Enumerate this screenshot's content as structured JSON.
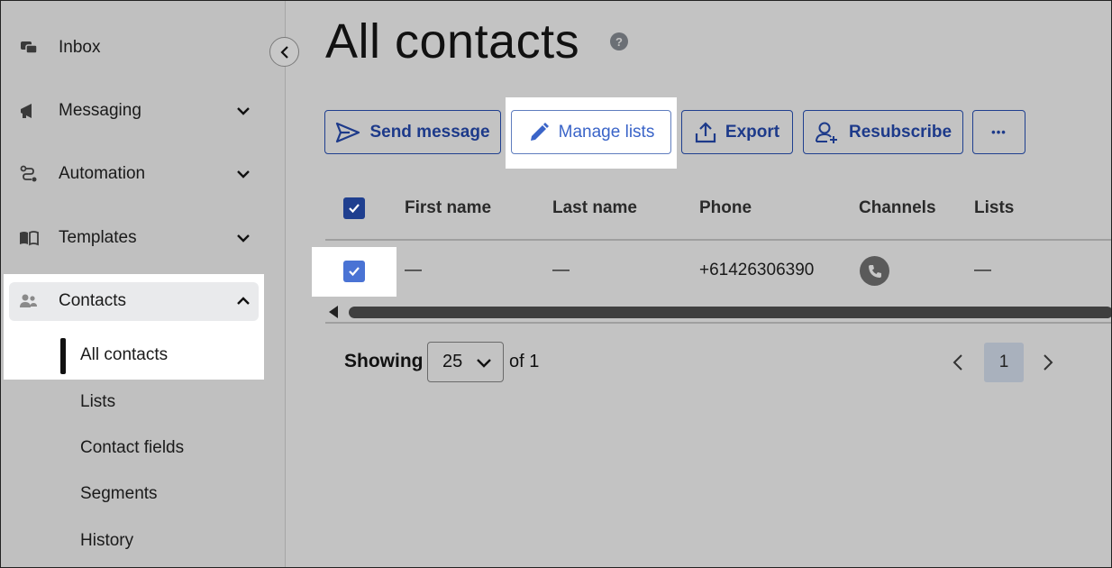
{
  "sidebar": {
    "items": [
      {
        "label": "Inbox",
        "icon": "chat-bubbles-icon"
      },
      {
        "label": "Messaging",
        "icon": "megaphone-icon"
      },
      {
        "label": "Automation",
        "icon": "flow-icon"
      },
      {
        "label": "Templates",
        "icon": "open-book-icon"
      },
      {
        "label": "Contacts",
        "icon": "people-icon"
      }
    ],
    "contacts_sub": [
      "All contacts",
      "Lists",
      "Contact fields",
      "Segments",
      "History"
    ]
  },
  "page": {
    "title": "All contacts"
  },
  "toolbar": {
    "send_message": "Send message",
    "manage_lists": "Manage lists",
    "export": "Export",
    "resubscribe": "Resubscribe",
    "more": "•••"
  },
  "table": {
    "headers": [
      "First name",
      "Last name",
      "Phone",
      "Channels",
      "Lists"
    ],
    "rows": [
      {
        "first_name": "—",
        "last_name": "—",
        "phone": "+61426306390",
        "channels": "phone-icon",
        "lists": "—"
      }
    ]
  },
  "pagination": {
    "showing_label": "Showing",
    "page_size": "25",
    "of_text": "of 1",
    "current_page": "1"
  },
  "colors": {
    "accent": "#1d3a8a",
    "checkbox_checked": "#4a73d4",
    "background_dim": "#c3c3c3"
  }
}
